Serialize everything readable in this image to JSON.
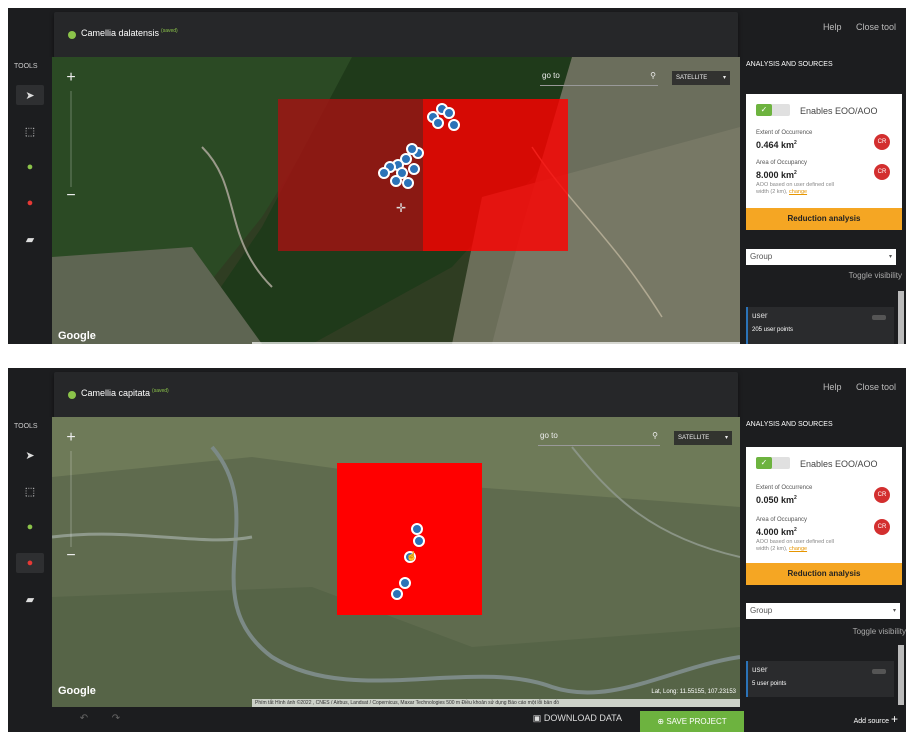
{
  "screens": [
    {
      "species": "Camellia dalatensis",
      "saved_tag": "(saved)",
      "top_links": {
        "help": "Help",
        "close": "Close tool"
      },
      "tools_label": "TOOLS",
      "search": {
        "value": "go to",
        "map_type": "SATELLITE"
      },
      "google_logo": "Google",
      "panel_title": "ANALYSIS AND SOURCES",
      "toggle_label": "Enables EOO/AOO",
      "eoo_label": "Extent of Occurrence",
      "eoo_value": "0.464 km",
      "eoo_status": "CR",
      "aoo_label": "Area of Occupancy",
      "aoo_value": "8.000 km",
      "aoo_status": "CR",
      "aoo_note": "AOO based on user defined cell width (2 km),",
      "aoo_change": "change",
      "reduction_label": "Reduction analysis",
      "group_label": "Group",
      "toggle_visibility": "Toggle visibility",
      "layer_name": "user",
      "layer_count": "205 user points"
    },
    {
      "species": "Camellia capitata",
      "saved_tag": "(saved)",
      "top_links": {
        "help": "Help",
        "close": "Close tool"
      },
      "tools_label": "TOOLS",
      "search": {
        "value": "go to",
        "map_type": "SATELLITE"
      },
      "google_logo": "Google",
      "attribution": "Phím tắt  Hình ảnh ©2022 , CNES / Airbus, Landsat / Copernicus, Maxar Technologies  500 m  Điều khoản sử dụng  Báo cáo một lỗi bản đồ",
      "coords": "Lat, Long: 11.55155, 107.23153",
      "panel_title": "ANALYSIS AND SOURCES",
      "toggle_label": "Enables EOO/AOO",
      "eoo_label": "Extent of Occurrence",
      "eoo_value": "0.050 km",
      "eoo_status": "CR",
      "aoo_label": "Area of Occupancy",
      "aoo_value": "4.000 km",
      "aoo_status": "CR",
      "aoo_note": "AOO based on user defined cell width (2 km),",
      "aoo_change": "change",
      "reduction_label": "Reduction analysis",
      "group_label": "Group",
      "toggle_visibility": "Toggle visibility",
      "layer_name": "user",
      "layer_count": "5 user points",
      "download_label": "DOWNLOAD DATA",
      "save_label": "SAVE PROJECT",
      "add_source_label": "Add source"
    }
  ],
  "colors": {
    "eoo_fill_dark": "#a31212",
    "eoo_fill_bright": "#ff0000",
    "point_fill": "#2b73b8",
    "accent_green": "#6db33f",
    "accent_orange": "#f5a623",
    "status_red": "#d32f2f"
  },
  "icons": [
    "pointer-icon",
    "select-icon",
    "add-point-icon",
    "remove-point-icon",
    "layers-icon",
    "search-icon",
    "undo-icon",
    "redo-icon",
    "download-icon",
    "save-icon",
    "plus-icon",
    "cursor-crosshair-icon"
  ]
}
